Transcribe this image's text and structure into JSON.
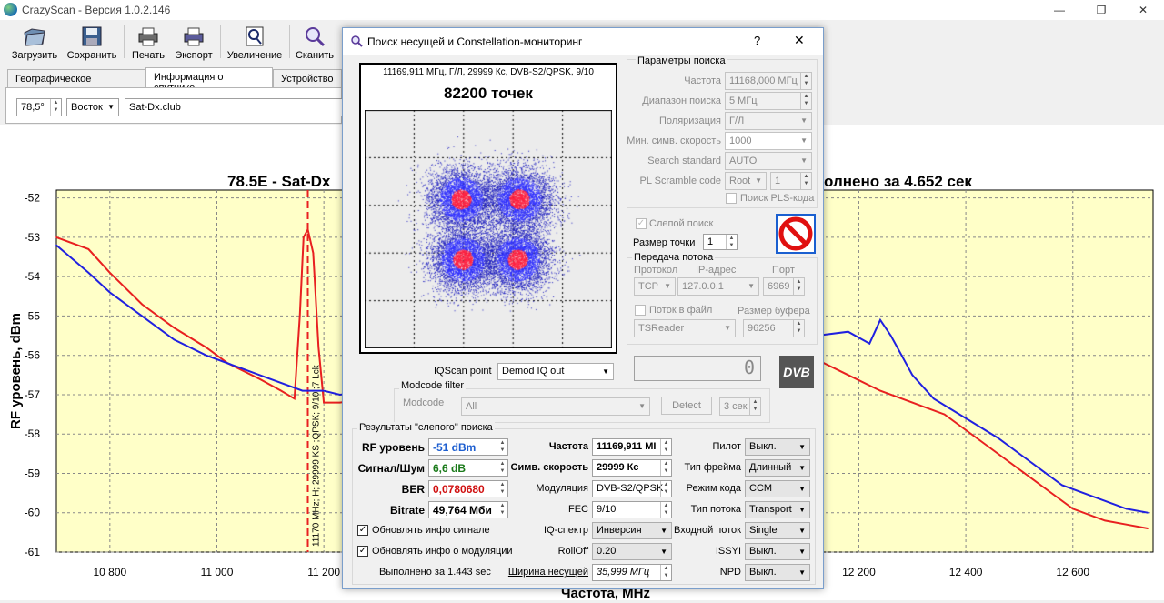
{
  "app": {
    "title": "CrazyScan - Версия 1.0.2.146",
    "controls": {
      "minimize": "—",
      "maximize": "❐",
      "close": "✕"
    }
  },
  "toolbar": {
    "load": "Загрузить",
    "save": "Сохранить",
    "print": "Печать",
    "export": "Экспорт",
    "zoom": "Увеличение",
    "scan": "Сканить"
  },
  "tabs": [
    "Географическое положение",
    "Информация о спутнике",
    "Устройство"
  ],
  "satellite": {
    "position": "78,5°",
    "direction": "Восток",
    "name": "Sat-Dx.club"
  },
  "chart_data": {
    "type": "line",
    "title_left": "78.5E - Sat-Dx",
    "title_right": "олнено за 4.652 сек",
    "xlabel": "Частота, MHz",
    "ylabel": "RF уровень, dBm",
    "xlim": [
      10700,
      12750
    ],
    "ylim": [
      -61,
      -51.8
    ],
    "xticks": [
      10800,
      11000,
      11200,
      12200,
      12400,
      12600
    ],
    "xtick_labels": [
      "10 800",
      "11 000",
      "11 200",
      "12 200",
      "12 400",
      "12 600"
    ],
    "yticks": [
      -52,
      -53,
      -54,
      -55,
      -56,
      -57,
      -58,
      -59,
      -60,
      -61
    ],
    "background": "#ffffc8",
    "marker": {
      "x": 11170,
      "label": "11170 MHz; H; 29999 KS ;QPSK; 9/10 ;7 Lck"
    },
    "series": [
      {
        "color": "#e82020",
        "x": [
          10700,
          10760,
          10800,
          10860,
          10920,
          10980,
          11020,
          11080,
          11120,
          11145,
          11155,
          11162,
          11170,
          11180,
          11190,
          11200,
          11230,
          12060,
          12120,
          12180,
          12240,
          12300,
          12360,
          12420,
          12480,
          12540,
          12600,
          12660,
          12700,
          12740
        ],
        "y": [
          -53.0,
          -53.3,
          -53.9,
          -54.7,
          -55.3,
          -55.8,
          -56.2,
          -56.6,
          -56.9,
          -57.1,
          -55.0,
          -53.0,
          -52.8,
          -53.4,
          -55.8,
          -57.2,
          -57.2,
          -55.7,
          -56.1,
          -56.5,
          -56.9,
          -57.2,
          -57.5,
          -58.1,
          -58.7,
          -59.3,
          -59.9,
          -60.2,
          -60.3,
          -60.4
        ]
      },
      {
        "color": "#2020e0",
        "x": [
          10700,
          10760,
          10800,
          10860,
          10920,
          10980,
          11040,
          11100,
          11160,
          11200,
          11230,
          12060,
          12120,
          12180,
          12220,
          12240,
          12260,
          12300,
          12340,
          12400,
          12460,
          12520,
          12580,
          12640,
          12700,
          12740
        ],
        "y": [
          -53.2,
          -53.9,
          -54.4,
          -55.0,
          -55.6,
          -56.0,
          -56.3,
          -56.6,
          -56.9,
          -56.9,
          -57.0,
          -55.6,
          -55.5,
          -55.4,
          -55.7,
          -55.1,
          -55.5,
          -56.5,
          -57.1,
          -57.6,
          -58.1,
          -58.7,
          -59.3,
          -59.6,
          -59.9,
          -60.0
        ]
      }
    ]
  },
  "dialog": {
    "title": "Поиск несущей и Constellation-мониторинг",
    "help": "?",
    "close": "✕",
    "constellation": {
      "info": "11169,911 МГц, Г/Л, 29999 Кс, DVB-S2/QPSK, 9/10",
      "points": "82200 точек"
    },
    "search_params": {
      "header": "Параметры поиска",
      "freq_label": "Частота",
      "freq_value": "11168,000 МГц",
      "range_label": "Диапазон поиска",
      "range_value": "5 МГц",
      "pol_label": "Поляризация",
      "pol_value": "Г/Л",
      "minsr_label": "Мин. симв. скорость",
      "minsr_value": "1000",
      "standard_label": "Search standard",
      "standard_value": "AUTO",
      "pls_label": "PL Scramble code",
      "pls_mode": "Root",
      "pls_value": "1",
      "pls_search": "Поиск PLS-кода"
    },
    "blind_search": "Слепой поиск",
    "point_size_label": "Размер точки",
    "point_size_value": "1",
    "stream": {
      "header": "Передача потока",
      "protocol_label": "Протокол",
      "ip_label": "IP-адрес",
      "port_label": "Порт",
      "protocol_value": "TCP",
      "ip_value": "127.0.0.1",
      "port_value": "6969",
      "to_file": "Поток в файл",
      "buffer_label": "Размер буфера",
      "player": "TSReader",
      "buffer_value": "96256"
    },
    "counter_value": "0",
    "iqscan_label": "IQScan point",
    "iqscan_value": "Demod IQ out",
    "modcode": {
      "header": "Modcode filter",
      "label": "Modcode",
      "value": "All",
      "detect": "Detect",
      "timeout": "3 сек"
    },
    "results": {
      "header": "Результаты \"слепого\" поиска",
      "rf_label": "RF уровень",
      "rf_value": "-51 dBm",
      "snr_label": "Сигнал/Шум",
      "snr_value": "6,6 dB",
      "ber_label": "BER",
      "ber_value": "0,0780680",
      "bitrate_label": "Bitrate",
      "bitrate_value": "49,764 Мби",
      "upd_signal": "Обновлять инфо сигнале",
      "upd_mod": "Обновлять инфо о модуляции",
      "done": "Выполнено за 1.443 sec",
      "freq_label": "Частота",
      "freq_value": "11169,911 МІ",
      "sr_label": "Симв. скорость",
      "sr_value": "29999 Кс",
      "modulation_label": "Модуляция",
      "modulation_value": "DVB-S2/QPSK",
      "fec_label": "FEC",
      "fec_value": "9/10",
      "iq_label": "IQ-спектр",
      "iq_value": "Инверсия",
      "rolloff_label": "RollOff",
      "rolloff_value": "0.20",
      "bw_label": "Ширина несущей",
      "bw_value": "35,999 МГц",
      "pilot_label": "Пилот",
      "pilot_value": "Выкл.",
      "frame_label": "Тип фрейма",
      "frame_value": "Длинный",
      "codemode_label": "Режим кода",
      "codemode_value": "CCM",
      "streamtype_label": "Тип потока",
      "streamtype_value": "Transport",
      "input_label": "Входной поток",
      "input_value": "Single",
      "issyi_label": "ISSYI",
      "issyi_value": "Выкл.",
      "npd_label": "NPD",
      "npd_value": "Выкл."
    }
  }
}
